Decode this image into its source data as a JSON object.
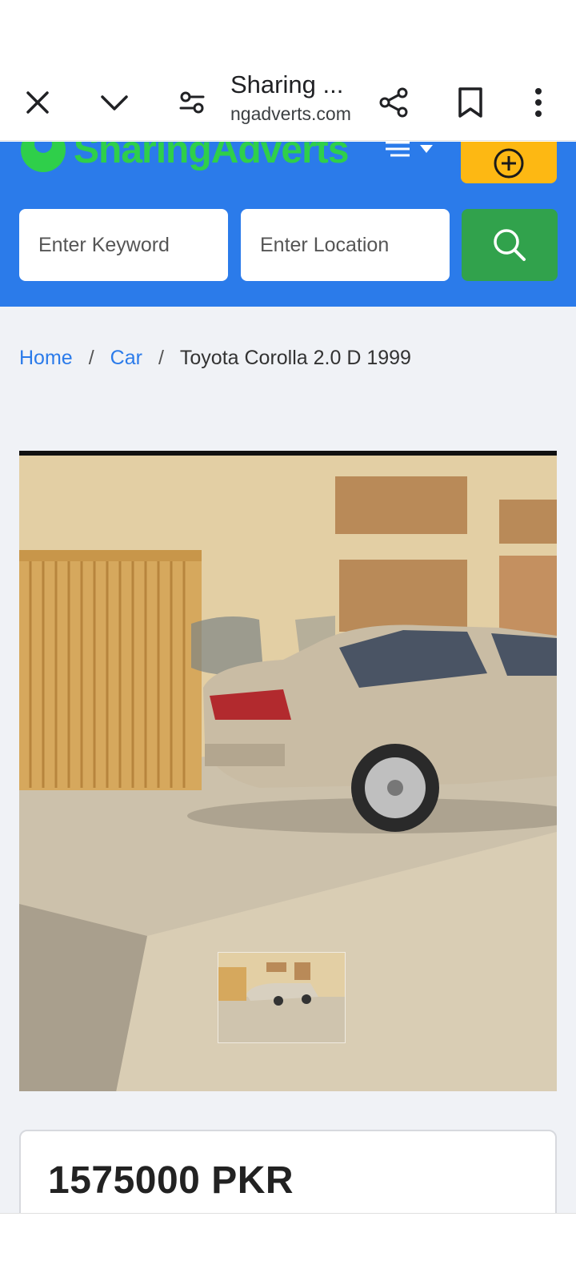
{
  "browser": {
    "title": "Sharing ...",
    "url": "ngadverts.com",
    "icons": [
      "close-icon",
      "chevron-down-icon",
      "site-settings-icon",
      "share-icon",
      "bookmark-icon",
      "more-vert-icon"
    ]
  },
  "header": {
    "logo_text": "SharingAdverts",
    "search_keyword_placeholder": "Enter Keyword",
    "search_location_placeholder": "Enter Location",
    "colors": {
      "header_bg": "#2b7bea",
      "logo": "#2fcf4a",
      "post_button": "#fdb813",
      "search_button": "#31a24c"
    }
  },
  "breadcrumb": {
    "home": "Home",
    "category": "Car",
    "current": "Toyota Corolla 2.0 D 1999"
  },
  "listing": {
    "price": "1575000 PKR"
  }
}
